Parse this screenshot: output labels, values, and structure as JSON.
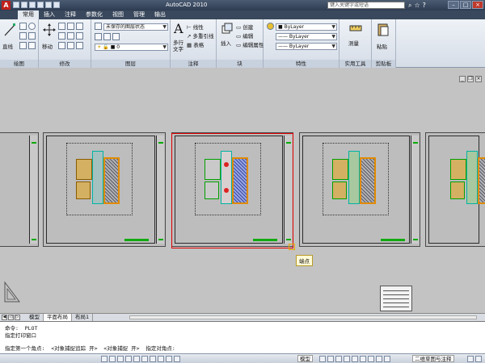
{
  "window": {
    "title": "AutoCAD 2010",
    "help_search_placeholder": "键入关键字或短语"
  },
  "ribbon_tabs": [
    "常用",
    "插入",
    "注释",
    "参数化",
    "视图",
    "管理",
    "输出"
  ],
  "ribbon": {
    "draw": {
      "title": "绘图",
      "line": "直线"
    },
    "modify": {
      "title": "修改",
      "move": "移动"
    },
    "layers": {
      "title": "图层",
      "layer_state": "未保存的图层状态",
      "current_layer": "0"
    },
    "annotation": {
      "title": "注释",
      "mtext": "多行",
      "text": "文字",
      "linear": "线性",
      "multileader": "多重引线",
      "table": "表格"
    },
    "block": {
      "title": "块",
      "insert": "插入",
      "create": "创建",
      "edit": "编辑",
      "edit_attributes": "编辑属性"
    },
    "properties": {
      "title": "特性",
      "color": "ByLayer",
      "linetype": "ByLayer",
      "lineweight": "ByLayer"
    },
    "utilities": {
      "title": "实用工具",
      "measure": "测量"
    },
    "clipboard": {
      "title": "剪贴板",
      "paste": "粘贴"
    }
  },
  "drawing": {
    "snap_tooltip": "端点"
  },
  "layout_tabs": [
    "模型",
    "平面布局",
    "布局1"
  ],
  "command_line": {
    "history": [
      "命令:  PLOT",
      "指定打印窗口"
    ],
    "prompt": "指定第一个角点:  <对象捕捉追踪 开>  <对象捕捉 开>  指定对角点:"
  },
  "statusbar": {
    "coords": "",
    "model_paper": "模型",
    "workspace": "二维草图与注释"
  },
  "colors": {
    "accent_red": "#e00000",
    "title_bar": "#2e3c52"
  }
}
